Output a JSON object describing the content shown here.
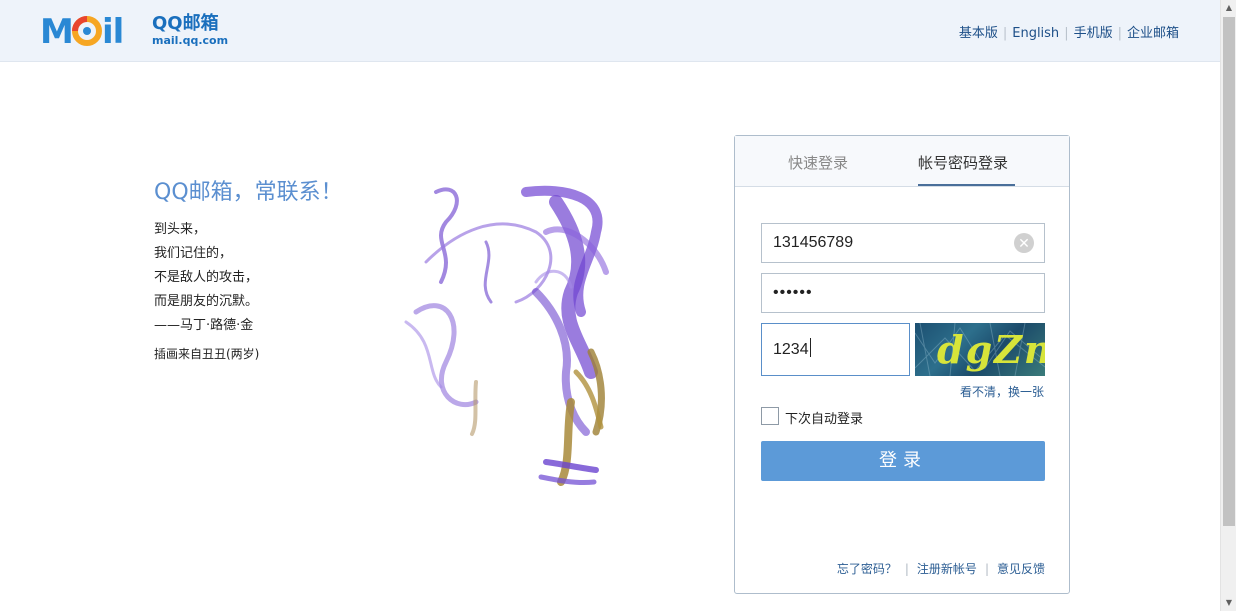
{
  "header": {
    "logo_mark": "Mail",
    "logo_name": "QQ邮箱",
    "logo_domain": "mail.qq.com",
    "links": [
      "基本版",
      "English",
      "手机版",
      "企业邮箱"
    ],
    "separator": "|"
  },
  "story": {
    "slogan": "QQ邮箱，常联系！",
    "poem": [
      "到头来，",
      "我们记住的，",
      "不是敌人的攻击，",
      "而是朋友的沉默。",
      "——马丁·路德·金"
    ],
    "credit": "插画来自丑丑(两岁)"
  },
  "login": {
    "tabs": [
      {
        "label": "快速登录",
        "active": false
      },
      {
        "label": "帐号密码登录",
        "active": true
      }
    ],
    "username": "131456789",
    "password": "••••••",
    "captcha_value": "1234",
    "captcha_image_text": "dgZn",
    "captcha_refresh": "看不清，换一张",
    "remember_label": "下次自动登录",
    "remember_checked": false,
    "submit_label": "登录",
    "footer": [
      "忘了密码？",
      "注册新帐号",
      "意见反馈"
    ],
    "footer_separator": "|"
  },
  "colors": {
    "brand": "#2a88d4",
    "slogan": "#5b8fd0",
    "button": "#5c9ad8",
    "link": "#1d4f88"
  }
}
